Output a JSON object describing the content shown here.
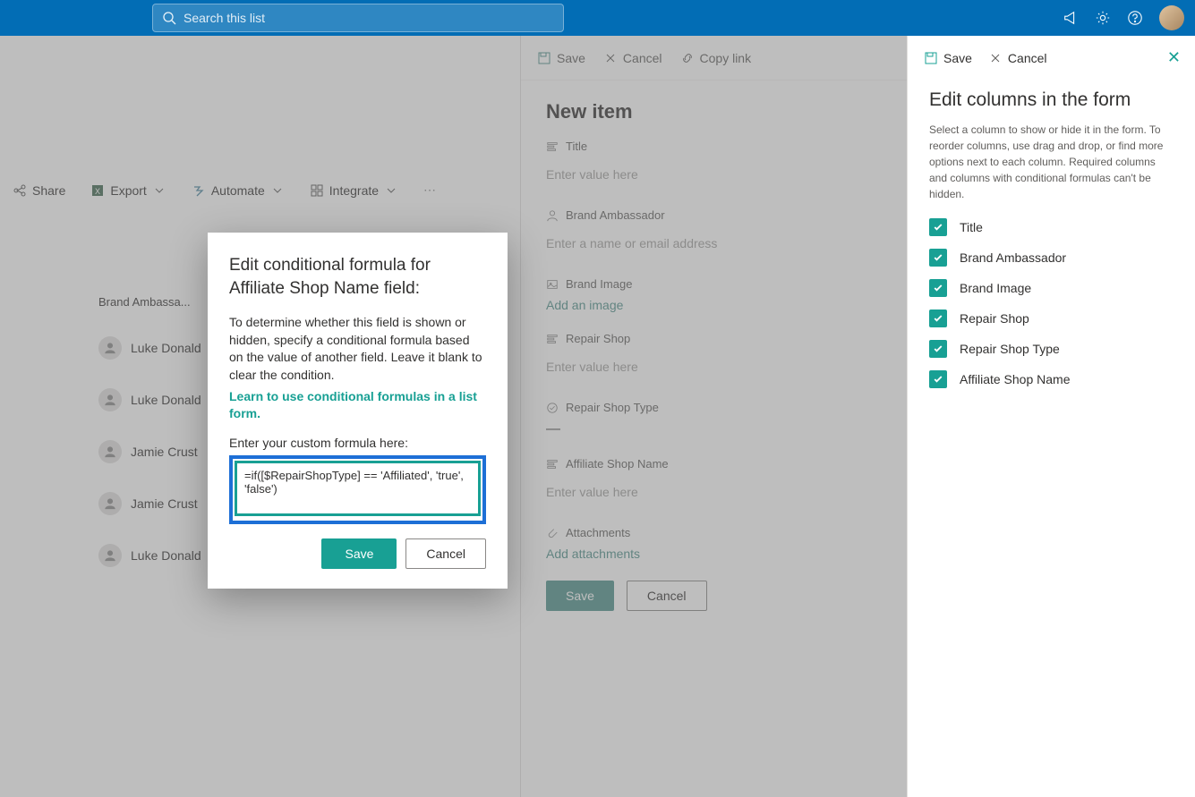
{
  "topbar": {
    "search_placeholder": "Search this list"
  },
  "commandbar": {
    "share": "Share",
    "export": "Export",
    "automate": "Automate",
    "integrate": "Integrate"
  },
  "list": {
    "column_header": "Brand Ambassa...",
    "people": [
      "Luke Donald",
      "Luke Donald",
      "Jamie Crust",
      "Jamie Crust",
      "Luke Donald"
    ]
  },
  "newitem": {
    "cmd_save": "Save",
    "cmd_cancel": "Cancel",
    "cmd_copylink": "Copy link",
    "title": "New item",
    "fields": {
      "title": {
        "label": "Title",
        "placeholder": "Enter value here"
      },
      "brand_ambassador": {
        "label": "Brand Ambassador",
        "placeholder": "Enter a name or email address"
      },
      "brand_image": {
        "label": "Brand Image",
        "action": "Add an image"
      },
      "repair_shop": {
        "label": "Repair Shop",
        "placeholder": "Enter value here"
      },
      "repair_shop_type": {
        "label": "Repair Shop Type",
        "placeholder": "—"
      },
      "affiliate_shop_name": {
        "label": "Affiliate Shop Name",
        "placeholder": "Enter value here"
      },
      "attachments": {
        "label": "Attachments",
        "action": "Add attachments"
      }
    },
    "save": "Save",
    "cancel": "Cancel"
  },
  "editpanel": {
    "cmd_save": "Save",
    "cmd_cancel": "Cancel",
    "title": "Edit columns in the form",
    "description": "Select a column to show or hide it in the form. To reorder columns, use drag and drop, or find more options next to each column. Required columns and columns with conditional formulas can't be hidden.",
    "columns": [
      "Title",
      "Brand Ambassador",
      "Brand Image",
      "Repair Shop",
      "Repair Shop Type",
      "Affiliate Shop Name"
    ]
  },
  "modal": {
    "title": "Edit conditional formula for Affiliate Shop Name field:",
    "text": "To determine whether this field is shown or hidden, specify a conditional formula based on the value of another field. Leave it blank to clear the condition.",
    "link": "Learn to use conditional formulas in a list form.",
    "formula_label": "Enter your custom formula here:",
    "formula": "=if([$RepairShopType] == 'Affiliated', 'true', 'false')",
    "save": "Save",
    "cancel": "Cancel"
  }
}
